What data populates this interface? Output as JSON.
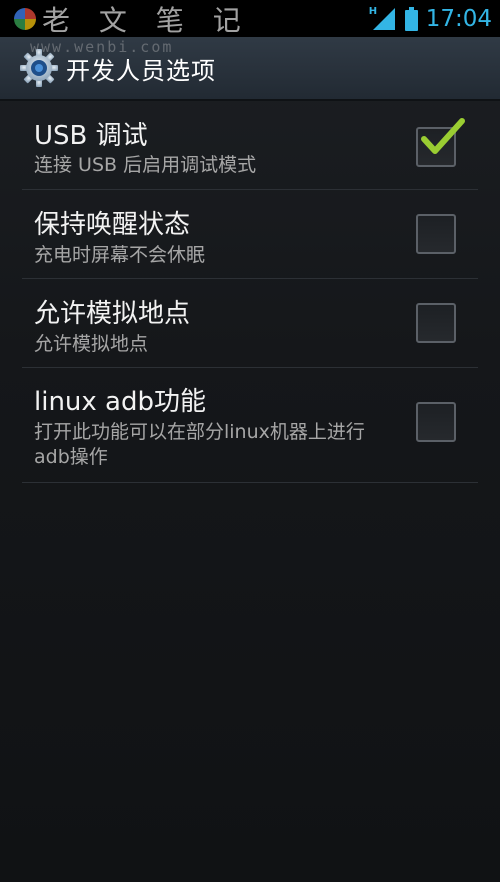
{
  "status_bar": {
    "watermark_chars": "老 文 笔 记",
    "watermark_url": "www.wenbi.com",
    "network_type": "H",
    "time": "17:04"
  },
  "action_bar": {
    "title": "开发人员选项",
    "icon": "settings-gear-icon"
  },
  "settings": [
    {
      "title": "USB 调试",
      "summary": "连接 USB 后启用调试模式",
      "checked": true
    },
    {
      "title": "保持唤醒状态",
      "summary": "充电时屏幕不会休眠",
      "checked": false
    },
    {
      "title": "允许模拟地点",
      "summary": "允许模拟地点",
      "checked": false
    },
    {
      "title": "linux adb功能",
      "summary": "打开此功能可以在部分linux机器上进行adb操作",
      "checked": false
    }
  ],
  "colors": {
    "accent": "#33b5e5",
    "check": "#9acd32"
  }
}
